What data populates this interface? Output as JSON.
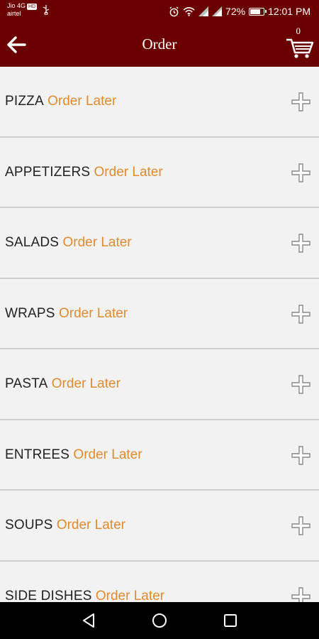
{
  "status_bar": {
    "carrier_line1": "Jio 4G",
    "carrier_badge": "HD",
    "carrier_line2": "airtel",
    "battery": "72%",
    "time": "12:01 PM"
  },
  "app_bar": {
    "title": "Order",
    "cart_count": "0"
  },
  "categories": [
    {
      "name": "PIZZA",
      "status": "Order Later"
    },
    {
      "name": "APPETIZERS",
      "status": "Order Later"
    },
    {
      "name": "SALADS",
      "status": "Order Later"
    },
    {
      "name": "WRAPS",
      "status": "Order Later"
    },
    {
      "name": "PASTA",
      "status": "Order Later"
    },
    {
      "name": "ENTREES",
      "status": "Order Later"
    },
    {
      "name": "SOUPS",
      "status": "Order Later"
    },
    {
      "name": "SIDE DISHES",
      "status": "Order Later"
    }
  ],
  "icons": {
    "back": "arrow-left-icon",
    "cart": "shopping-cart-icon",
    "expand": "plus-icon",
    "nav_back": "triangle-back-icon",
    "nav_home": "circle-home-icon",
    "nav_recents": "square-recents-icon"
  },
  "colors": {
    "header": "#6b0000",
    "accent": "#e08a2e",
    "background": "#f2f2f2"
  }
}
